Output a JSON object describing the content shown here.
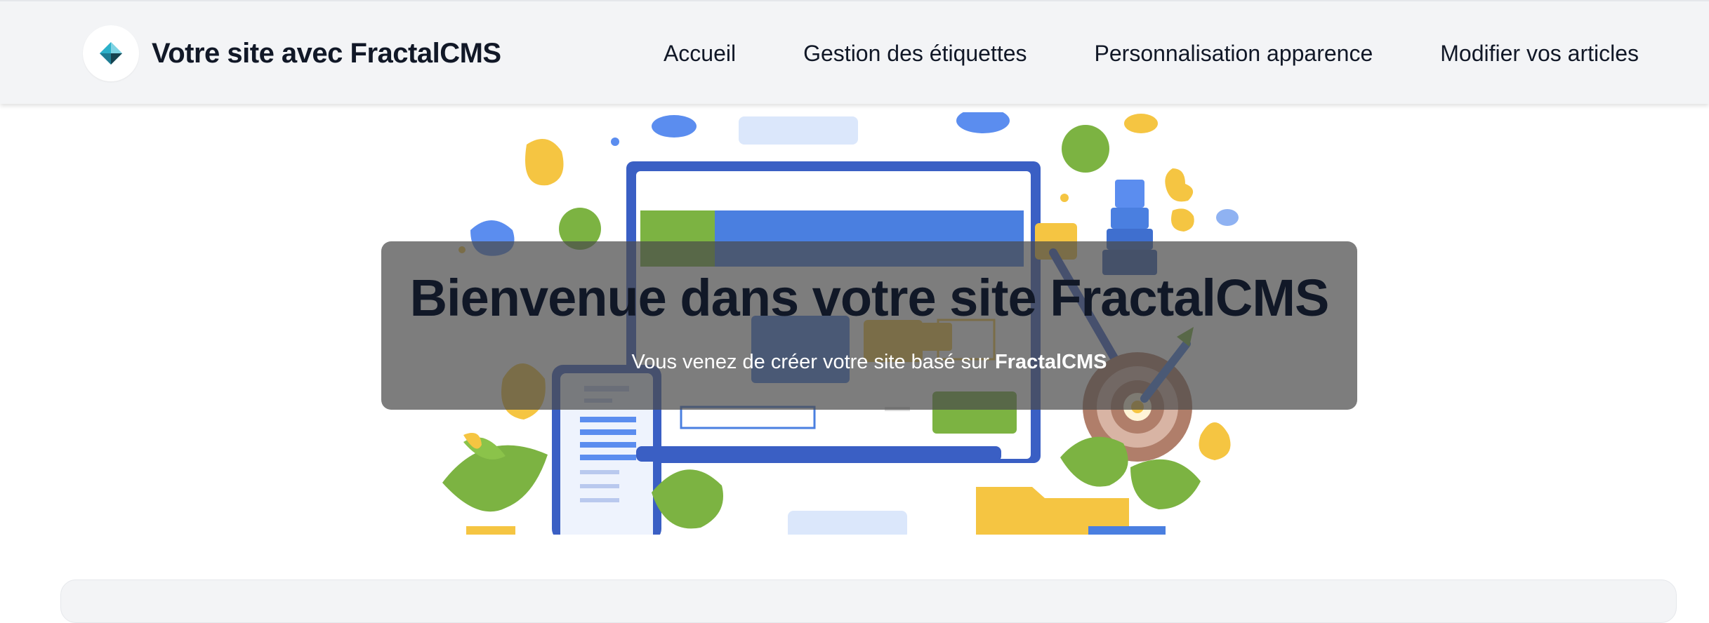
{
  "header": {
    "site_title": "Votre site avec FractalCMS",
    "logo_icon": "fractal-diamond-logo",
    "nav": [
      {
        "label": "Accueil"
      },
      {
        "label": "Gestion des étiquettes"
      },
      {
        "label": "Personnalisation apparence"
      },
      {
        "label": "Modifier vos articles"
      }
    ]
  },
  "hero": {
    "title": "Bienvenue dans votre site FractalCMS",
    "subtitle_prefix": "Vous venez de créer votre site basé sur ",
    "subtitle_brand": "FractalCMS",
    "illustration": "cms-dashboard-illustration"
  },
  "colors": {
    "header_bg": "#f3f4f6",
    "text_dark": "#111827",
    "overlay": "rgba(75,75,75,0.72)",
    "accent_blue": "#4a7fe0",
    "accent_green": "#7cb342",
    "accent_yellow": "#f5c542"
  }
}
